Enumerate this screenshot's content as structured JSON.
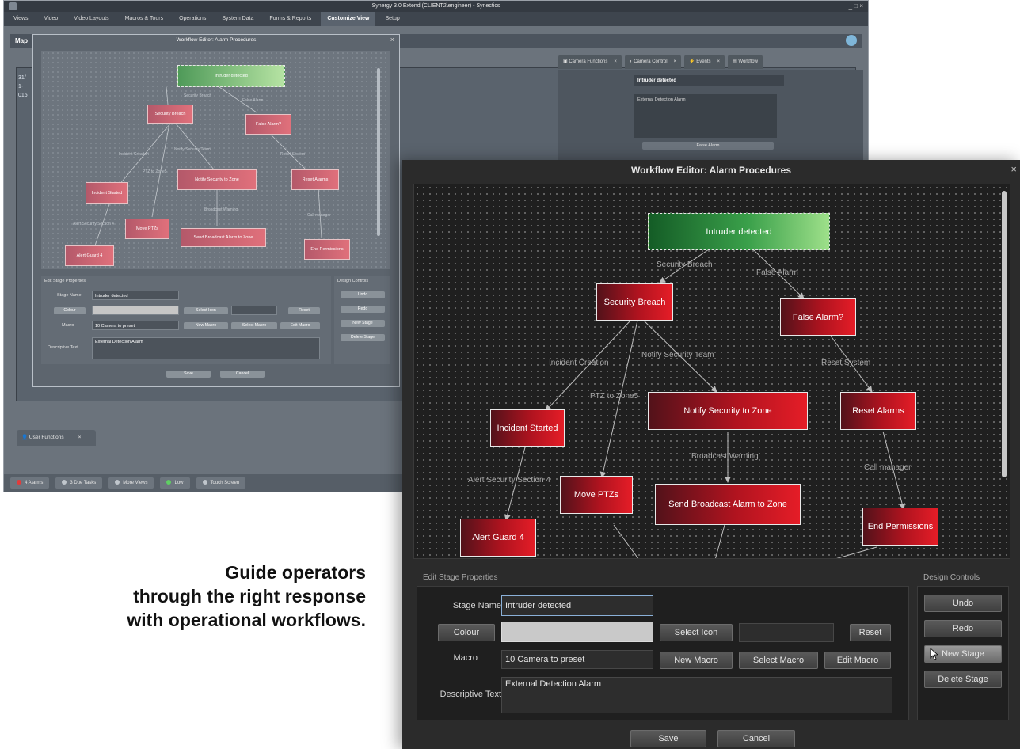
{
  "app": {
    "title": "Synergy 3.0 Extend (CLIENT2\\engineer) - Synectics",
    "window_controls": "_ □ ×",
    "menu": [
      "Views",
      "Video",
      "Video Layouts",
      "Macros & Tours",
      "Operations",
      "System Data",
      "Forms & Reports",
      "Customize View",
      "Setup"
    ],
    "active_menu": "Customize View",
    "map_label": "Map",
    "side_text": [
      "31/",
      "1-",
      "015"
    ],
    "right_tabs": [
      "Camera Functions",
      "Camera Control",
      "Events",
      "Workflow"
    ],
    "tab_close": "×",
    "right_panel": {
      "title": "Intruder detected",
      "description": "External Detection Alarm",
      "button": "False Alarm"
    },
    "user_tab": "User Functions",
    "bottom_items": [
      "4 Alarms",
      "3 Due Tasks",
      "More Views",
      "Low",
      "Touch Screen"
    ]
  },
  "small_editor": {
    "title": "Workflow Editor: Alarm Procedures",
    "close": "×",
    "nodes": [
      "Intruder detected",
      "Security Breach",
      "False Alarm?",
      "Incident Started",
      "Notify Security to Zone",
      "Reset Alarms",
      "Move PTZs",
      "Send Broadcast Alarm to Zone",
      "Alert Guard 4",
      "End Permissions"
    ],
    "edges": [
      "Security Breach",
      "False Alarm",
      "Incident Creation",
      "Notify Security Team",
      "Reset System",
      "PTZ to Zone5",
      "Broadcast Warning",
      "Call manager",
      "Alert Security Section 4"
    ],
    "props_label": "Edit Stage Properties",
    "controls_label": "Design Controls",
    "stage_name_label": "Stage Name",
    "stage_name": "Intruder detected",
    "colour_btn": "Colour",
    "select_icon": "Select Icon",
    "reset": "Reset",
    "macro_label": "Macro",
    "macro_value": "10 Camera to preset",
    "new_macro": "New Macro",
    "select_macro": "Select Macro",
    "edit_macro": "Edit Macro",
    "desc_label": "Descriptive Text",
    "desc_value": "External Detection Alarm",
    "undo": "Undo",
    "redo": "Redo",
    "new_stage": "New Stage",
    "delete_stage": "Delete Stage",
    "save": "Save",
    "cancel": "Cancel"
  },
  "editor": {
    "title": "Workflow Editor: Alarm Procedures",
    "close": "×",
    "nodes": {
      "intruder": "Intruder detected",
      "breach": "Security Breach",
      "false_alarm": "False Alarm?",
      "incident": "Incident Started",
      "notify": "Notify Security to Zone",
      "reset_alarms": "Reset Alarms",
      "move_ptz": "Move PTZs",
      "broadcast": "Send Broadcast Alarm to Zone",
      "alert_guard": "Alert Guard 4",
      "end_perm": "End Permissions"
    },
    "edges": {
      "security_breach": "Security Breach",
      "false_alarm": "False Alarm",
      "incident_creation": "Incident Creation",
      "notify_team": "Notify Security Team",
      "reset_system": "Reset System",
      "ptz_zone": "PTZ to Zone5",
      "broadcast_warning": "Broadcast Warning",
      "call_manager": "Call manager",
      "alert_section": "Alert Security Section 4"
    },
    "props": {
      "section_label": "Edit Stage Properties",
      "stage_name_label": "Stage Name",
      "stage_name": "Intruder detected",
      "colour_button": "Colour",
      "select_icon": "Select Icon",
      "reset": "Reset",
      "macro_label": "Macro",
      "macro_value": "10 Camera to preset",
      "new_macro": "New Macro",
      "select_macro": "Select Macro",
      "edit_macro": "Edit Macro",
      "desc_label": "Descriptive Text",
      "desc_value": "External Detection Alarm"
    },
    "controls": {
      "section_label": "Design Controls",
      "undo": "Undo",
      "redo": "Redo",
      "new_stage": "New Stage",
      "delete_stage": "Delete Stage"
    },
    "footer": {
      "save": "Save",
      "cancel": "Cancel"
    }
  },
  "tagline": [
    "Guide operators",
    "through the right response",
    "with operational workflows."
  ]
}
